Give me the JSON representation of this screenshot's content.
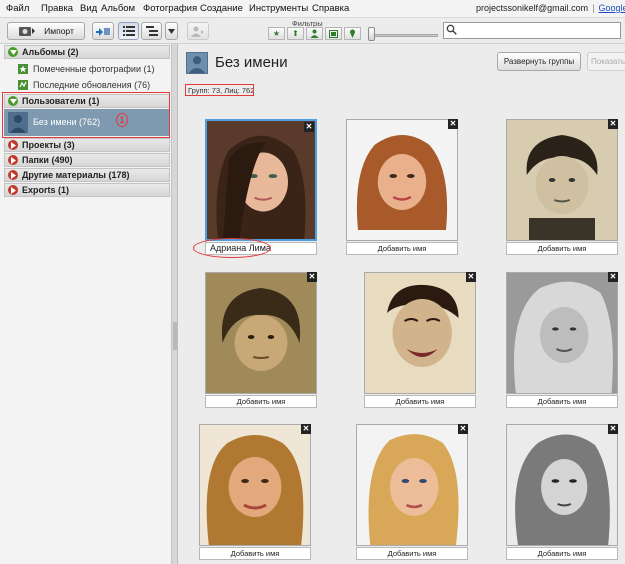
{
  "menu": [
    "Файл",
    "Правка",
    "Вид",
    "Альбом",
    "Фотография",
    "Создание",
    "Инструменты",
    "Справка"
  ],
  "account": {
    "email": "projectssonikelf@gmail.com",
    "separator": "|",
    "link": "Google+ Фо"
  },
  "toolbar": {
    "import_label": "Импорт",
    "filters_label": "Фильтры",
    "search_placeholder": ""
  },
  "sidebar": {
    "albums": {
      "label": "Альбомы (2)",
      "items": [
        "Помеченные фотографии (1)",
        "Последние обновления (76)"
      ]
    },
    "users": {
      "label": "Пользователи (1)",
      "selected": "Без имени (762)"
    },
    "annotation_number": "1",
    "sections": [
      "Проекты (3)",
      "Папки (490)",
      "Другие материалы (178)",
      "Exports (1)"
    ]
  },
  "main": {
    "title": "Без имени",
    "info": "Групп: 73, Лиц: 762",
    "expand_button": "Развернуть группы",
    "show_button": "Показать"
  },
  "faces": [
    {
      "name": "Адриана Лима",
      "typed": true,
      "selected": true
    },
    {
      "name": "Добавить имя",
      "typed": false
    },
    {
      "name": "Добавить имя",
      "typed": false
    },
    {
      "name": "Добавить имя",
      "typed": false
    },
    {
      "name": "Добавить имя",
      "typed": false
    },
    {
      "name": "Добавить имя",
      "typed": false
    },
    {
      "name": "Добавить имя",
      "typed": false
    },
    {
      "name": "Добавить имя",
      "typed": false
    },
    {
      "name": "Добавить имя",
      "typed": false
    }
  ],
  "colors": {
    "accent": "#4f9fe0",
    "annotation": "#e53a3a",
    "selected_row": "#7f9ab0"
  },
  "icons": [
    "import-icon",
    "upload-icon",
    "list-view-icon",
    "tree-view-icon",
    "dropdown-icon",
    "star-filter-icon",
    "upload-filter-icon",
    "person-filter-icon",
    "video-filter-icon",
    "geo-filter-icon",
    "search-icon"
  ]
}
